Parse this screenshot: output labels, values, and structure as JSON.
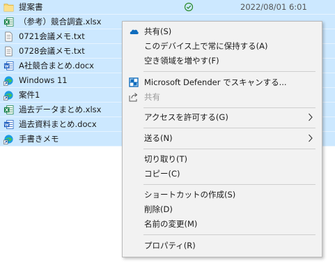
{
  "files": [
    {
      "name": "提案書",
      "icon": "folder-icon",
      "status": "synced-check-icon",
      "date": "2022/08/01 6:01"
    },
    {
      "name": "（参考）競合調査.xlsx",
      "icon": "excel-file-icon"
    },
    {
      "name": "0721会議メモ.txt",
      "icon": "text-file-icon"
    },
    {
      "name": "0728会議メモ.txt",
      "icon": "text-file-icon"
    },
    {
      "name": "A社競合まとめ.docx",
      "icon": "word-file-icon"
    },
    {
      "name": "Windows 11",
      "icon": "edge-shortcut-icon"
    },
    {
      "name": "案件1",
      "icon": "edge-shortcut-icon"
    },
    {
      "name": "過去データまとめ.xlsx",
      "icon": "excel-file-icon"
    },
    {
      "name": "過去資料まとめ.docx",
      "icon": "word-file-icon"
    },
    {
      "name": "手書きメモ",
      "icon": "edge-shortcut-icon"
    }
  ],
  "context_menu": {
    "onedrive_share": "共有(S)",
    "always_keep": "このデバイス上で常に保持する(A)",
    "free_space": "空き領域を増やす(F)",
    "defender_scan": "Microsoft Defender でスキャンする...",
    "share": "共有",
    "give_access": "アクセスを許可する(G)",
    "send_to": "送る(N)",
    "cut": "切り取り(T)",
    "copy": "コピー(C)",
    "create_shortcut": "ショートカットの作成(S)",
    "delete": "削除(D)",
    "rename": "名前の変更(M)",
    "properties": "プロパティ(R)"
  },
  "colors": {
    "selection": "#cce8ff",
    "menu_bg": "#f2f2f2",
    "onedrive_blue": "#0f6cbd",
    "excel_green": "#107c41",
    "word_blue": "#185abd",
    "folder_yellow": "#f8d775",
    "synced_green": "#2a8a2a"
  }
}
